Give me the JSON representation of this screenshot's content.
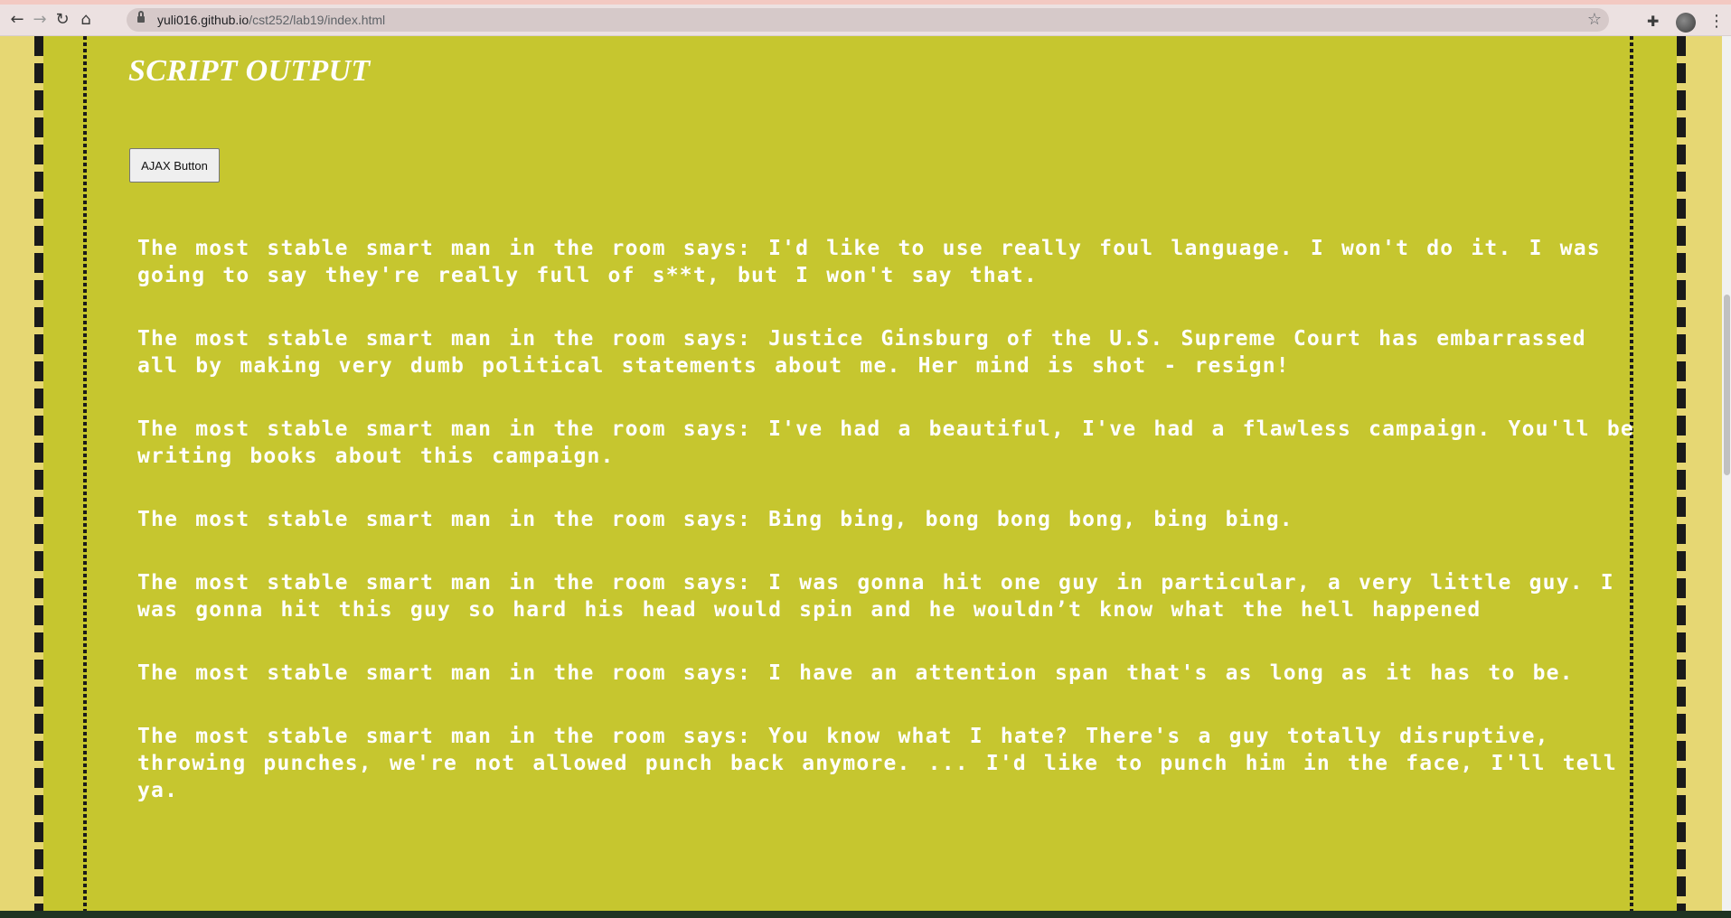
{
  "browser": {
    "url_host": "yuli016.github.io",
    "url_path": "/cst252/lab19/index.html"
  },
  "page": {
    "title": "SCRIPT OUTPUT",
    "ajax_button_label": "AJAX Button"
  },
  "quotes": [
    "The most stable smart man in the room says: I'd like to use really foul language. I won't do it. I was going to say they're really full of s**t, but I won't say that.",
    "The most stable smart man in the room says: Justice Ginsburg of the U.S. Supreme Court has embarrassed all by making very dumb political statements about me. Her mind is shot - resign!",
    "The most stable smart man in the room says: I've had a beautiful, I've had a flawless campaign. You'll be writing books about this campaign.",
    "The most stable smart man in the room says: Bing bing, bong bong bong, bing bing.",
    "The most stable smart man in the room says: I was gonna hit one guy in particular, a very little guy. I was gonna hit this guy so hard his head would spin and he wouldn’t know what the hell happened",
    "The most stable smart man in the room says: I have an attention span that's as long as it has to be.",
    "The most stable smart man in the room says: You know what I hate? There's a guy totally disruptive, throwing punches, we're not allowed punch back anymore. ... I'd like to punch him in the face, I'll tell ya."
  ]
}
